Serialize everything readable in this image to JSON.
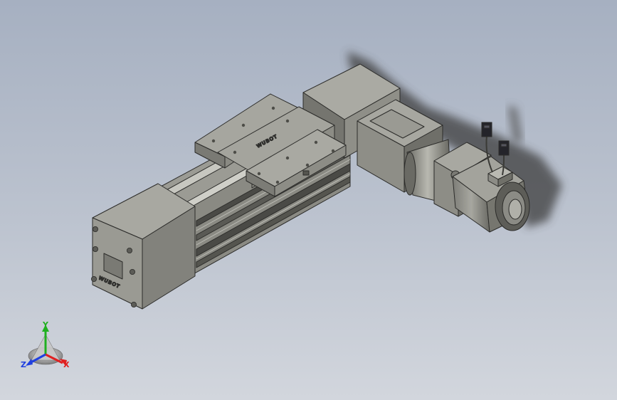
{
  "model": {
    "logo_text_end_cap": "WUBOT",
    "logo_text_carriage": "WUBOT"
  },
  "triad": {
    "x_label": "X",
    "y_label": "Y",
    "z_label": "Z",
    "colors": {
      "x": "#e02020",
      "y": "#20b020",
      "z": "#2040e0"
    }
  },
  "colors": {
    "body_light": "#a9a9a2",
    "body_mid": "#8e8e87",
    "body_dark": "#5f5f59",
    "edge": "#2c2c2a",
    "shadow": "#3b3b3b"
  }
}
